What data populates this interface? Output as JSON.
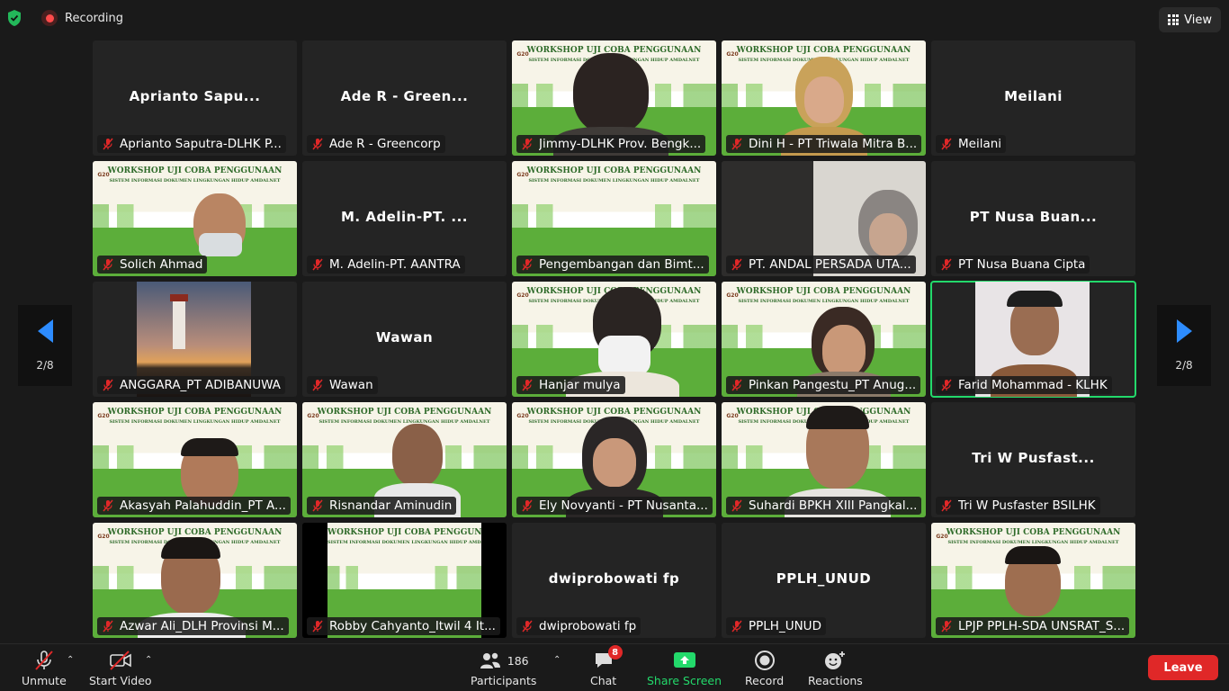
{
  "top": {
    "recording": "Recording",
    "view": "View"
  },
  "tiles": [
    {
      "label": "Aprianto Saputra-DLHK P...",
      "name": "Aprianto Sapu..."
    },
    {
      "label": "Ade R - Greencorp",
      "name": "Ade R - Green..."
    },
    {
      "label": "Jimmy-DLHK Prov. Bengk..."
    },
    {
      "label": "Dini H - PT Triwala Mitra B..."
    },
    {
      "label": "Meilani",
      "name": "Meilani"
    },
    {
      "label": "Solich Ahmad"
    },
    {
      "label": "M. Adelin-PT. AANTRA",
      "name": "M. Adelin-PT. ..."
    },
    {
      "label": "Pengembangan dan Bimt..."
    },
    {
      "label": "PT. ANDAL PERSADA UTA..."
    },
    {
      "label": "PT Nusa Buana Cipta",
      "name": "PT Nusa Buan..."
    },
    {
      "label": "ANGGARA_PT ADIBANUWA"
    },
    {
      "label": "Wawan",
      "name": "Wawan"
    },
    {
      "label": "Hanjar mulya"
    },
    {
      "label": "Pinkan Pangestu_PT Anug..."
    },
    {
      "label": "Farid Mohammad - KLHK"
    },
    {
      "label": "Akasyah Palahuddin_PT A..."
    },
    {
      "label": "Risnandar Aminudin"
    },
    {
      "label": "Ely Novyanti - PT Nusanta..."
    },
    {
      "label": "Suhardi BPKH XIII Pangkal..."
    },
    {
      "label": "Tri W Pusfaster BSILHK",
      "name": "Tri W Pusfast..."
    },
    {
      "label": "Azwar Ali_DLH Provinsi M..."
    },
    {
      "label": "Robby Cahyanto_Itwil 4 It..."
    },
    {
      "label": "dwiprobowati fp",
      "name": "dwiprobowati fp"
    },
    {
      "label": "PPLH_UNUD",
      "name": "PPLH_UNUD"
    },
    {
      "label": "LPJP PPLH-SDA UNSRAT_S..."
    }
  ],
  "banner": {
    "title": "WORKSHOP UJI COBA PENGGUNAAN",
    "subtitle": "SISTEM INFORMASI DOKUMEN LINGKUNGAN HIDUP AMDALNET",
    "logo": "G20"
  },
  "pager": {
    "left": "2/8",
    "right": "2/8"
  },
  "toolbar": {
    "unmute": "Unmute",
    "start_video": "Start Video",
    "participants": "Participants",
    "participants_count": "186",
    "chat": "Chat",
    "chat_badge": "8",
    "share_screen": "Share Screen",
    "record": "Record",
    "reactions": "Reactions",
    "leave": "Leave"
  },
  "colors": {
    "accent": "#2d8cff",
    "active_speaker": "#23d96b",
    "leave": "#e02828",
    "share": "#23d96b"
  }
}
